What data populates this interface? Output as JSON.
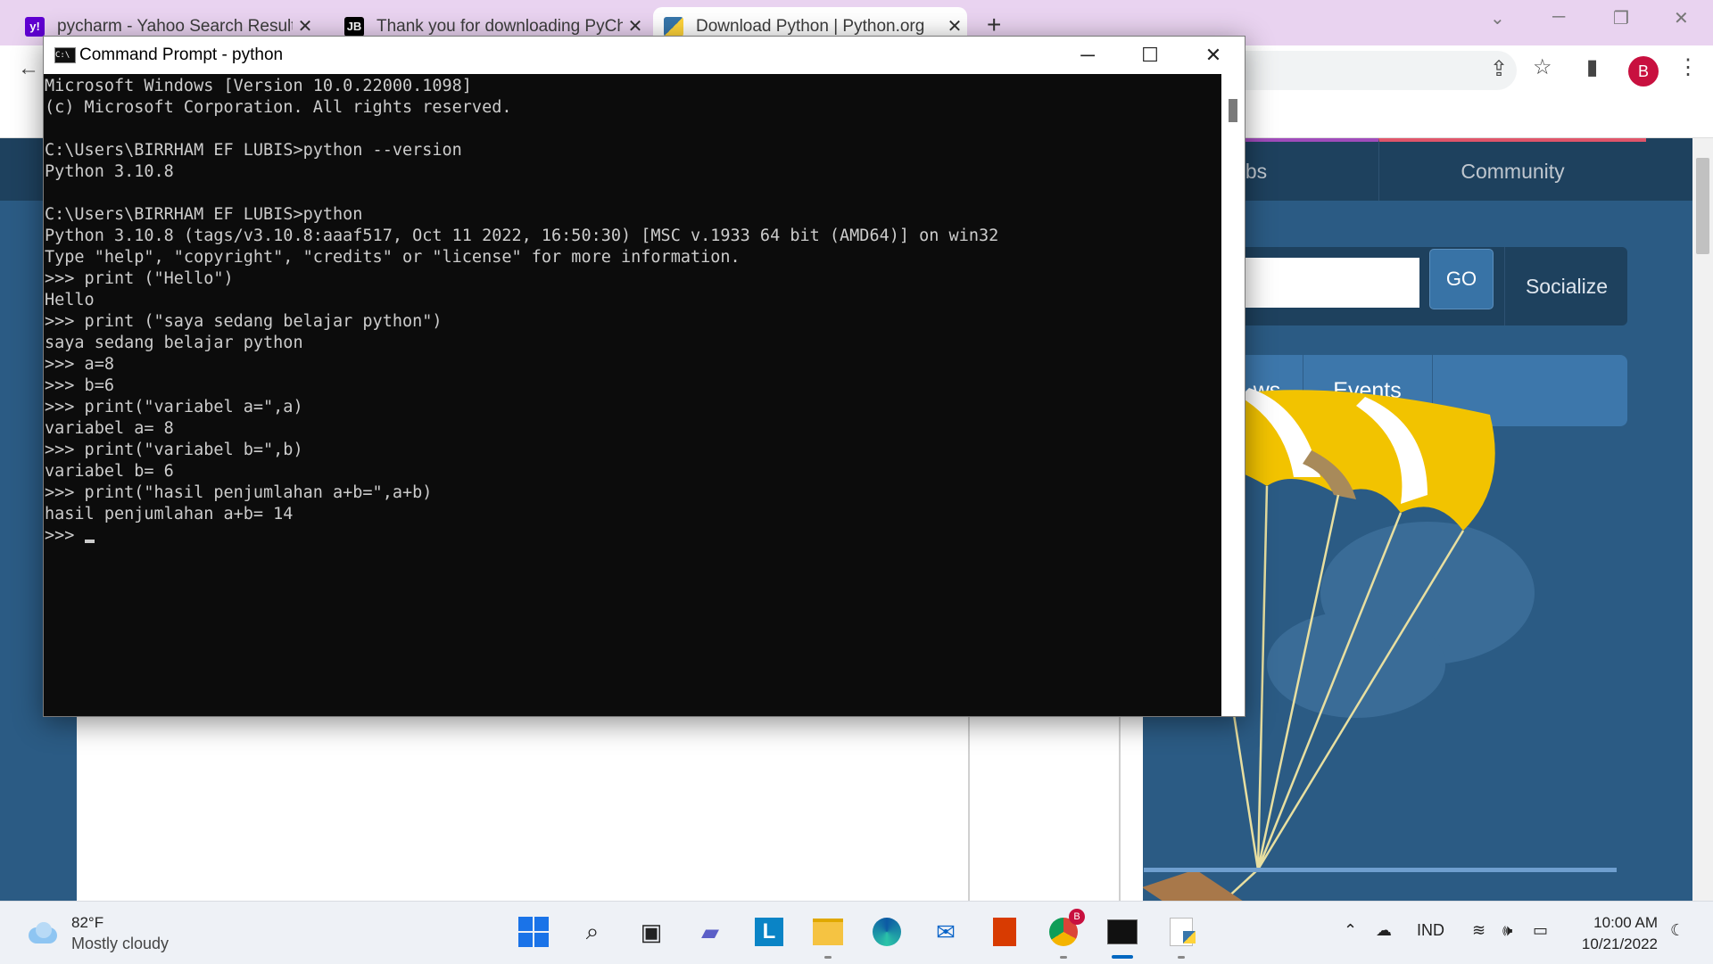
{
  "browser": {
    "tabs": [
      {
        "title": "pycharm - Yahoo Search Results",
        "favicon": "y!",
        "favicon_color": "#6001d2"
      },
      {
        "title": "Thank you for downloading PyCh",
        "favicon": "JB",
        "favicon_color": "#000000"
      },
      {
        "title": "Download Python | Python.org",
        "favicon": "python-logo",
        "favicon_color": "#3776ab"
      }
    ],
    "profile_initial": "B"
  },
  "website": {
    "nav": {
      "jobs": "bs",
      "community": "Community"
    },
    "go_label": "GO",
    "socialize_label": "Socialize",
    "subnav": {
      "news": "ws",
      "events": "Events"
    },
    "colors": {
      "background": "#2b5b84",
      "topbar": "#1e415e",
      "accent": "#3873a6"
    }
  },
  "cmd": {
    "title": "Command Prompt - python",
    "lines": [
      "Microsoft Windows [Version 10.0.22000.1098]",
      "(c) Microsoft Corporation. All rights reserved.",
      "",
      "C:\\Users\\BIRRHAM EF LUBIS>python --version",
      "Python 3.10.8",
      "",
      "C:\\Users\\BIRRHAM EF LUBIS>python",
      "Python 3.10.8 (tags/v3.10.8:aaaf517, Oct 11 2022, 16:50:30) [MSC v.1933 64 bit (AMD64)] on win32",
      "Type \"help\", \"copyright\", \"credits\" or \"license\" for more information.",
      ">>> print (\"Hello\")",
      "Hello",
      ">>> print (\"saya sedang belajar python\")",
      "saya sedang belajar python",
      ">>> a=8",
      ">>> b=6",
      ">>> print(\"variabel a=\",a)",
      "variabel a= 8",
      ">>> print(\"variabel b=\",b)",
      "variabel b= 6",
      ">>> print(\"hasil penjumlahan a+b=\",a+b)",
      "hasil penjumlahan a+b= 14"
    ],
    "prompt": ">>> "
  },
  "taskbar": {
    "weather_temp": "82°F",
    "weather_desc": "Mostly cloudy",
    "language": "IND",
    "time": "10:00 AM",
    "date": "10/21/2022",
    "chrome_badge": "B"
  }
}
